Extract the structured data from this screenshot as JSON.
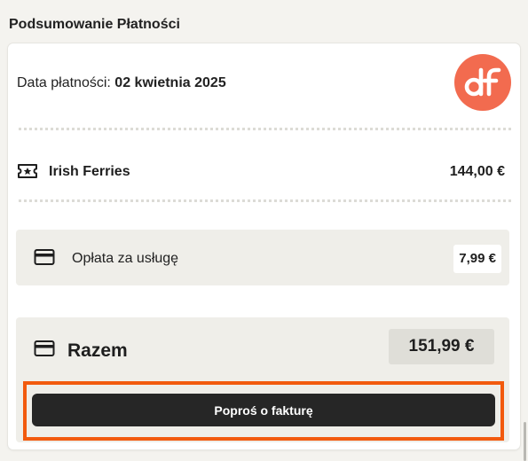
{
  "summary": {
    "title": "Podsumowanie Płatności",
    "date_label": "Data płatności:",
    "date_value": "02 kwietnia 2025"
  },
  "logo": {
    "text": "df",
    "color": "#f26b4f"
  },
  "ticket": {
    "icon": "ticket-star-icon",
    "name": "Irish Ferries",
    "price": "144,00 €"
  },
  "fee": {
    "icon": "credit-card-icon",
    "label": "Opłata za usługę",
    "price": "7,99 €"
  },
  "total": {
    "icon": "credit-card-icon",
    "label": "Razem",
    "price": "151,99 €"
  },
  "actions": {
    "invoice_label": "Poproś o fakturę"
  },
  "colors": {
    "accent_highlight": "#f25a0e",
    "button_bg": "#262626",
    "panel_bg": "#efeee9"
  }
}
